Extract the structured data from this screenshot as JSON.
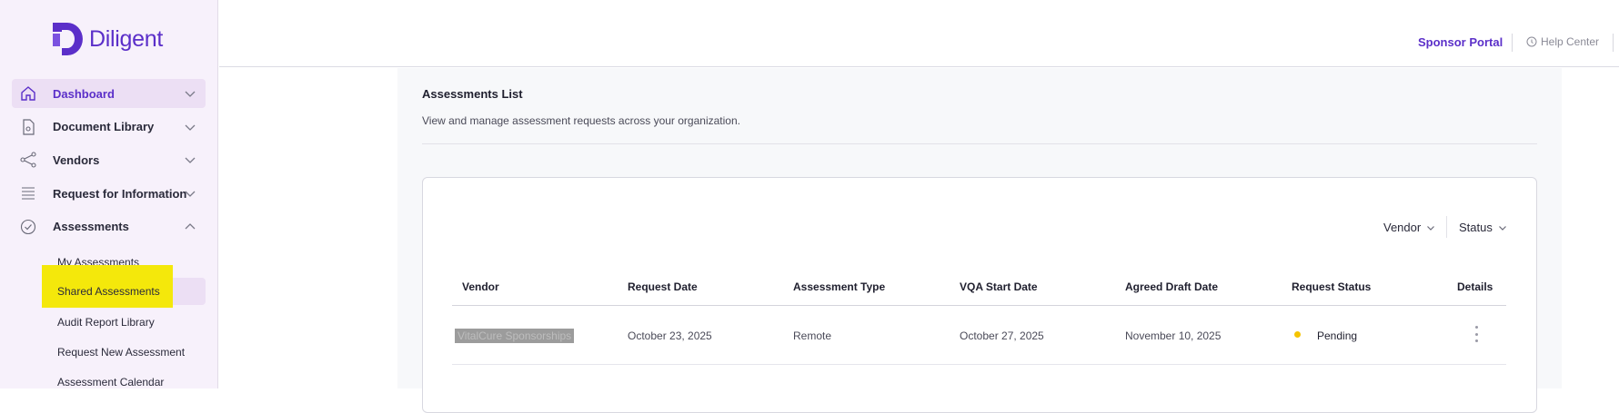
{
  "app": {
    "logo_text": "Diligent",
    "brand_color": "#5b2fc9",
    "highlight_color": "#f4e80b"
  },
  "sidebar": {
    "items": [
      {
        "label": "Dashboard",
        "icon": "home-icon",
        "active": true,
        "expanded": false
      },
      {
        "label": "Document Library",
        "icon": "document-icon",
        "active": false,
        "expanded": false
      },
      {
        "label": "Vendors",
        "icon": "share-icon",
        "active": false,
        "expanded": false
      },
      {
        "label": "Request for Information",
        "icon": "list-icon",
        "active": false,
        "expanded": false
      },
      {
        "label": "Assessments",
        "icon": "check-circle-icon",
        "active": false,
        "expanded": true
      }
    ],
    "sub_items": [
      {
        "label": "My Assessments"
      },
      {
        "label": "Shared Assessments",
        "active": true
      },
      {
        "label": "Audit Report Library"
      },
      {
        "label": "Request New Assessment"
      },
      {
        "label": "Assessment Calendar"
      }
    ]
  },
  "topbar": {
    "sponsor_portal": "Sponsor Portal",
    "help_center": "Help Center"
  },
  "main": {
    "title": "Assessments List",
    "subtitle": "View and manage assessment requests across your organization.",
    "filters": {
      "vendor": "Vendor",
      "status": "Status"
    },
    "table": {
      "headers": [
        "Vendor",
        "Request Date",
        "Assessment Type",
        "VQA Start Date",
        "Agreed Draft Date",
        "Request Status",
        "Details"
      ],
      "rows": [
        {
          "vendor": "VitalCure Sponsorships",
          "request_date": "October 23, 2025",
          "assessment_type": "Remote",
          "vqa_start_date": "October 27, 2025",
          "agreed_draft_date": "November 10, 2025",
          "request_status": "Pending",
          "status_color": "#f5c400"
        }
      ]
    }
  }
}
